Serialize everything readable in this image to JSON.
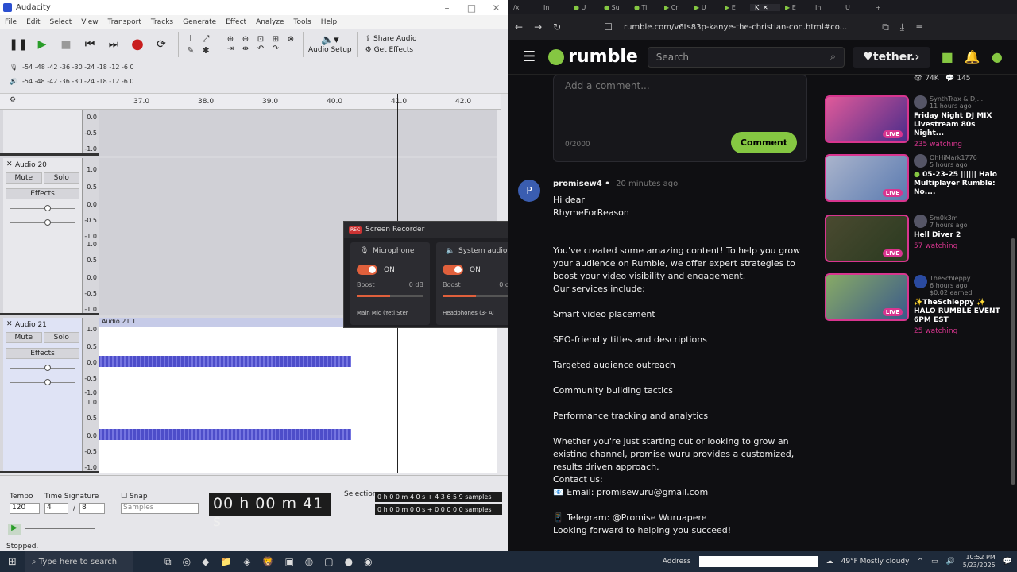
{
  "audacity": {
    "title": "Audacity",
    "menu": [
      "File",
      "Edit",
      "Select",
      "View",
      "Transport",
      "Tracks",
      "Generate",
      "Effect",
      "Analyze",
      "Tools",
      "Help"
    ],
    "share_audio": "Share Audio",
    "get_effects": "Get Effects",
    "audio_setup": "Audio Setup",
    "meter_ticks": "-54 -48 -42 -36 -30 -24 -18 -12 -6 0",
    "timeline": [
      "37.0",
      "38.0",
      "39.0",
      "40.0",
      "41.0",
      "42.0"
    ],
    "tracks": [
      {
        "name": "Audio 20",
        "mute": "Mute",
        "solo": "Solo",
        "effects": "Effects"
      },
      {
        "name": "Audio 21",
        "mute": "Mute",
        "solo": "Solo",
        "effects": "Effects",
        "clip": "Audio 21.1"
      }
    ],
    "scale": [
      "1.0",
      "0.5",
      "0.0",
      "-0.5",
      "-1.0"
    ],
    "tempo_label": "Tempo",
    "tempo": "120",
    "timesig_label": "Time Signature",
    "timesig_num": "4",
    "timesig_den": "8",
    "snap": "Snap",
    "snap_unit": "Samples",
    "time": "00 h 00 m 41 s",
    "selection_label": "Selection",
    "sel_start": "0 h 0 0 m 4 0 s + 4 3 6 5 9 samples",
    "sel_end": "0 h 0 0 m 0 0 s + 0 0 0 0 0 samples",
    "status": "Stopped."
  },
  "recorder": {
    "title": "Screen Recorder",
    "rec_badge": "REC",
    "mic_label": "Microphone",
    "mic_on": "ON",
    "mic_boost": "Boost",
    "mic_db": "0 dB",
    "mic_device": "Main Mic (Yeti Ster",
    "sys_label": "System audio",
    "sys_on": "ON",
    "sys_boost": "Boost",
    "sys_db": "0 d",
    "sys_device": "Headphones (3- Ai"
  },
  "browser": {
    "tabs": [
      "/x",
      "In",
      "U",
      "Su",
      "Ti",
      "Cr",
      "U",
      "E",
      "Kı",
      "E",
      "In",
      "U"
    ],
    "url": "rumble.com/v6ts83p-kanye-the-christian-con.html#co...",
    "search_placeholder": "Search",
    "tether": "tether.",
    "comment_placeholder": "Add a comment...",
    "comment_count": "0/2000",
    "comment_button": "Comment",
    "comment_author": "promisew4",
    "comment_time": "20 minutes ago",
    "comment_avatar": "P",
    "comment_lines": [
      "Hi dear",
      "RhymeForReason",
      "",
      "You've created some amazing content! To help you grow your audience on Rumble, we offer expert strategies to boost your video visibility and engagement.",
      "Our services include:",
      "",
      "Smart video placement",
      "",
      "SEO-friendly titles and descriptions",
      "",
      "Targeted audience outreach",
      "",
      "Community building tactics",
      "",
      "Performance tracking and analytics",
      "",
      "Whether you're just starting out or looking to grow an existing channel, promise wuru provides a customized, results driven approach.",
      "Contact us:",
      "📧 Email: promisewuru@gmail.com",
      "",
      "📱 Telegram: @Promise Wuruapere",
      "Looking forward to helping you succeed!"
    ],
    "top_stats": {
      "views": "74K",
      "comments": "145"
    },
    "videos": [
      {
        "channel": "SynthTrax & DJ...",
        "time": "11 hours ago",
        "title": "Friday Night DJ MIX Livestream 80s Night...",
        "watching": "235 watching",
        "live": "LIVE"
      },
      {
        "channel": "OhHiMark1776",
        "time": "5 hours ago",
        "title": "05-23-25 |||||| Halo Multiplayer Rumble: No....",
        "watching": "",
        "live": "LIVE"
      },
      {
        "channel": "Sm0k3m",
        "time": "7 hours ago",
        "title": "Hell Diver 2",
        "watching": "57 watching",
        "live": "LIVE"
      },
      {
        "channel": "TheSchleppy",
        "time": "6 hours ago",
        "earned": "$0.02 earned",
        "title": "✨TheSchleppy ✨ HALO RUMBLE EVENT 6PM EST",
        "watching": "25 watching",
        "live": "LIVE"
      }
    ]
  },
  "taskbar": {
    "search": "Type here to search",
    "address_label": "Address",
    "weather": "49°F  Mostly cloudy",
    "time": "10:52 PM",
    "date": "5/23/2025"
  },
  "colors": {
    "rumble_green": "#85c742",
    "live_pink": "#d8358f",
    "wave": "#4d4dc9"
  }
}
